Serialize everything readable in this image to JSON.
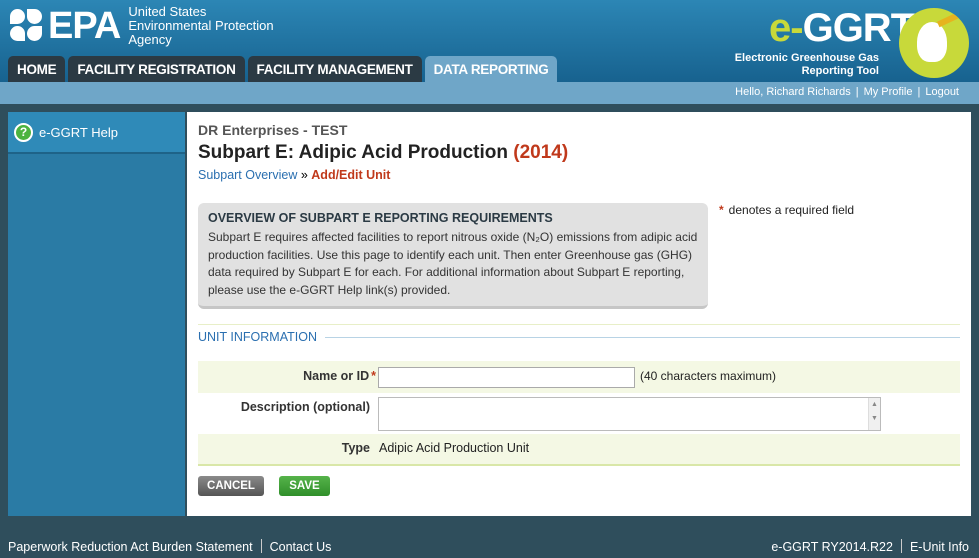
{
  "header": {
    "epa_word": "EPA",
    "agency_lines": [
      "United States",
      "Environmental Protection",
      "Agency"
    ],
    "ggrt_e": "e-",
    "ggrt_rest": "GGRT",
    "ggrt_subtitle_lines": [
      "Electronic Greenhouse Gas",
      "Reporting Tool"
    ]
  },
  "nav": {
    "tabs": [
      {
        "label": "HOME"
      },
      {
        "label": "FACILITY REGISTRATION"
      },
      {
        "label": "FACILITY MANAGEMENT"
      },
      {
        "label": "DATA REPORTING"
      }
    ]
  },
  "userbar": {
    "greeting": "Hello, Richard Richards",
    "profile": "My Profile",
    "logout": "Logout"
  },
  "sidebar": {
    "help_label": "e-GGRT Help"
  },
  "main": {
    "facility": "DR Enterprises - TEST",
    "title": "Subpart E: Adipic Acid Production",
    "year": "(2014)",
    "breadcrumb_link": "Subpart Overview",
    "breadcrumb_sep": "»",
    "breadcrumb_current": "Add/Edit Unit",
    "overview_heading": "OVERVIEW OF SUBPART E REPORTING REQUIREMENTS",
    "overview_text": "Subpart E requires affected facilities to report nitrous oxide (N₂O) emissions from adipic acid production facilities. Use this page to identify each unit. Then enter Greenhouse gas (GHG) data required by Subpart E for each. For additional information about Subpart E reporting, please use the e-GGRT Help link(s) provided.",
    "required_star": "*",
    "required_text": "denotes a required field",
    "section_title": "UNIT INFORMATION",
    "form": {
      "name_label": "Name or ID",
      "name_star": "*",
      "name_value": "",
      "name_hint": "(40 characters maximum)",
      "desc_label": "Description (optional)",
      "desc_value": "",
      "type_label": "Type",
      "type_value": "Adipic Acid Production Unit"
    },
    "cancel_label": "CANCEL",
    "save_label": "SAVE"
  },
  "footer": {
    "paperwork": "Paperwork Reduction Act Burden Statement",
    "contact": "Contact Us",
    "version": "e-GGRT RY2014.R22",
    "eunit": "E-Unit Info"
  },
  "colors": {
    "header_blue": "#1f6f9e",
    "tab_dark": "#2b3a44",
    "tab_active": "#6fa6c8",
    "accent_red": "#c0391b",
    "save_green": "#2f8f2a"
  }
}
